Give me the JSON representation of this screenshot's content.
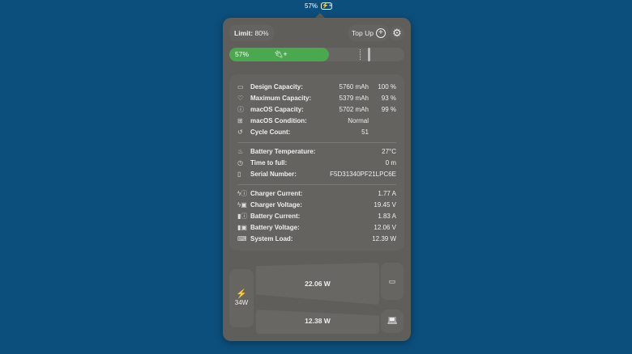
{
  "menubar": {
    "percent": "57%",
    "icon": "battery-charging-icon"
  },
  "header": {
    "limit_label": "Limit:",
    "limit_value": "80%",
    "topup_label": "Top Up"
  },
  "battery_bar": {
    "percent_label": "57%",
    "charge_fraction": 0.57,
    "limit_fraction": 0.8,
    "color": "#4aa84e"
  },
  "info": {
    "capacity": [
      {
        "icon": "battery-icon",
        "label": "Design Capacity:",
        "value": "5760 mAh",
        "pct": "100 %"
      },
      {
        "icon": "health-icon",
        "label": "Maximum Capacity:",
        "value": "5379 mAh",
        "pct": "93 %"
      },
      {
        "icon": "info-icon",
        "label": "macOS Capacity:",
        "value": "5702 mAh",
        "pct": "99 %"
      },
      {
        "icon": "medkit-icon",
        "label": "macOS Condition:",
        "value": "Normal",
        "pct": ""
      },
      {
        "icon": "history-icon",
        "label": "Cycle Count:",
        "value": "51",
        "pct": ""
      }
    ],
    "status": [
      {
        "icon": "thermometer-icon",
        "label": "Battery Temperature:",
        "value": "27°C"
      },
      {
        "icon": "clock-icon",
        "label": "Time to full:",
        "value": "0 m"
      },
      {
        "icon": "device-icon",
        "label": "Serial Number:",
        "value": "F5D31340PF21LPC6E"
      }
    ],
    "power": [
      {
        "icon": "charger-current-icon",
        "label": "Charger Current:",
        "value": "1.77 A"
      },
      {
        "icon": "charger-voltage-icon",
        "label": "Charger Voltage:",
        "value": "19.45 V"
      },
      {
        "icon": "battery-current-icon",
        "label": "Battery Current:",
        "value": "1.83 A"
      },
      {
        "icon": "battery-voltage-icon",
        "label": "Battery Voltage:",
        "value": "12.06 V"
      },
      {
        "icon": "laptop-icon",
        "label": "System Load:",
        "value": "12.39 W"
      }
    ]
  },
  "flow": {
    "source": "34W",
    "to_battery": "22.06 W",
    "to_system": "12.38 W"
  }
}
